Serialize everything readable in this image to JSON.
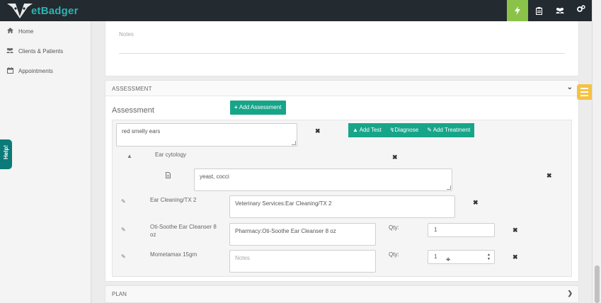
{
  "brand": {
    "name": "etBadger"
  },
  "topbar": {
    "icons": [
      "lightning-icon",
      "clipboard-icon",
      "users-icon",
      "gears-icon"
    ],
    "active_color": "#8bc34a"
  },
  "sidebar": {
    "items": [
      {
        "label": "Home",
        "icon": "home-icon"
      },
      {
        "label": "Clients & Patients",
        "icon": "users-icon"
      },
      {
        "label": "Appointments",
        "icon": "calendar-icon"
      }
    ],
    "help_label": "Help!"
  },
  "notes_section": {
    "placeholder": "Notes"
  },
  "assessment_panel": {
    "header": "ASSESSMENT",
    "title": "Assessment",
    "add_button": "Add Assessment",
    "assessment_text": "red smelly ears",
    "actions": {
      "add_test": "Add Test",
      "diagnose": "Diagnose",
      "add_treatment": "Add Treatment"
    },
    "test": {
      "name": "Ear cytology",
      "result": "yeast, cocci"
    },
    "treatments": [
      {
        "name": "Ear Cleaning/TX 2",
        "product": "Veterinary Services:Ear Cleaning/TX 2"
      },
      {
        "name": "Oti-Soothe Ear Cleanser 8 oz",
        "product": "Pharmacy:Oti-Soothe Ear Cleanser 8 oz",
        "qty_label": "Qty:",
        "qty": "1"
      },
      {
        "name": "Mometamax 15gm",
        "notes_placeholder": "Notes",
        "qty_label": "Qty:",
        "qty": "1"
      }
    ]
  },
  "plan_panel": {
    "header": "PLAN"
  },
  "colors": {
    "accent": "#17a589",
    "topbar": "#232a30",
    "brand": "#2bb3b1",
    "widget": "#f5c242"
  }
}
